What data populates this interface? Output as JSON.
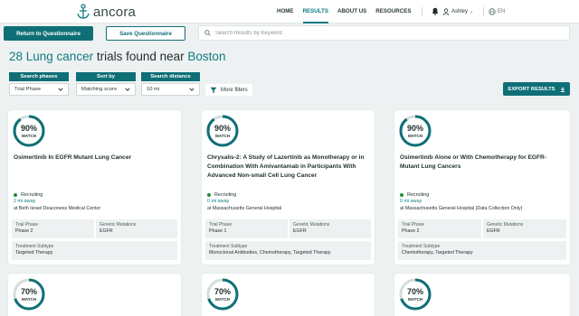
{
  "header": {
    "logo_text": "ancora",
    "nav": [
      "HOME",
      "RESULTS",
      "ABOUT US",
      "RESOURCES"
    ],
    "active_nav": "RESULTS",
    "user_name": "Ashley",
    "language": "EN"
  },
  "toolbar": {
    "return_label": "Return to Questionnaire",
    "save_label": "Save Questionnaire",
    "search_placeholder": "Search Results by Keyword"
  },
  "summary": {
    "count_topic": "28 Lung cancer",
    "middle": "trials found near",
    "location": "Boston"
  },
  "filters": {
    "phases_label": "Search phases",
    "phases_value": "Trial Phase",
    "sort_label": "Sort by",
    "sort_value": "Matching score",
    "distance_label": "Search distance",
    "distance_value": "10 mi",
    "more_filters": "More filters",
    "export_label": "EXPORT RESULTS"
  },
  "match_label": "MATCH",
  "field_labels": {
    "phase": "Trial Phase",
    "mutations": "Genetic Mutations",
    "subtype": "Treatment Subtype"
  },
  "cards": [
    {
      "match": "90%",
      "match_fraction": 0.9,
      "title": "Osimertinib In EGFR Mutant Lung Cancer",
      "status": "Recruiting",
      "distance": "2 mi away",
      "site": "at Beth Israel Deaconess Medical Center",
      "phase": "Phase 2",
      "mutations": "EGFR",
      "subtype": "Targeted Therapy"
    },
    {
      "match": "90%",
      "match_fraction": 0.9,
      "title": "Chrysalis-2: A Study of Lazertinib as Monotherapy or in Combination With Amivantamab in Participants With Advanced Non-small Cell Lung Cancer",
      "status": "Recruiting",
      "distance": "0 mi away",
      "site": "at Massachusetts General Hospital",
      "phase": "Phase 1",
      "mutations": "EGFR",
      "subtype": "Monoclonal Antibodies, Chemotherapy, Targeted Therapy"
    },
    {
      "match": "90%",
      "match_fraction": 0.9,
      "title": "Osimertinib Alone or With Chemotherapy for EGFR-Mutant Lung Cancers",
      "status": "Recruiting",
      "distance": "0 mi away",
      "site": "at Massachusetts General Hospital (Data Collection Only)",
      "phase": "Phase 2",
      "mutations": "EGFR",
      "subtype": "Chemotherapy, Targeted Therapy"
    },
    {
      "match": "70%",
      "match_fraction": 0.7
    },
    {
      "match": "70%",
      "match_fraction": 0.7
    },
    {
      "match": "70%",
      "match_fraction": 0.7
    }
  ],
  "colors": {
    "accent": "#0f6f77",
    "accent_text": "#0f7a82",
    "recruiting": "#1e8f3a",
    "page_bg": "#eef1f1"
  },
  "icons": [
    "anchor-logo-icon",
    "bell-icon",
    "user-icon",
    "globe-icon",
    "search-icon",
    "chevron-down-icon",
    "filter-icon",
    "download-icon"
  ]
}
